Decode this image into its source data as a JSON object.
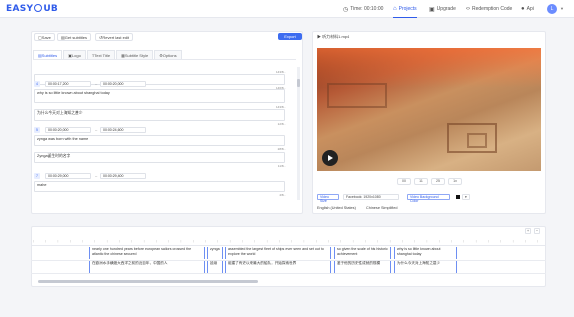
{
  "header": {
    "logo_text": "EASY",
    "logo_text2": "UB",
    "nav": [
      {
        "label": "Time: 00:10:00",
        "icon": "clock-icon"
      },
      {
        "label": "Projects",
        "icon": "home-icon"
      },
      {
        "label": "Upgrade",
        "icon": "lock-icon"
      },
      {
        "label": "Redemption Code",
        "icon": "code-icon"
      },
      {
        "label": "Api",
        "icon": "github-icon"
      }
    ],
    "avatar": "L"
  },
  "toolbar": {
    "save": "Save",
    "get_subtitles": "Get subtitles",
    "revert": "Revert last edit",
    "export": "Export"
  },
  "tabs": [
    "Subtitles",
    "Logo",
    "Text Title",
    "Subtitle Style",
    "Options"
  ],
  "subtitles": [
    {
      "index": "",
      "start": "",
      "end": "",
      "text": "",
      "count": "143/8..."
    },
    {
      "index": "",
      "start": "",
      "end": "",
      "text": "",
      "count": "146/8..."
    },
    {
      "index": "4",
      "start": "00:00:17,200",
      "end": "00:00:20,000",
      "text": "why is so little known about shanghai today",
      "count": "143/8..."
    },
    {
      "index": "",
      "start": "",
      "end": "",
      "text": "为什么今天对上海知之甚少",
      "count": "12/8..."
    },
    {
      "index": "5",
      "start": "00:00:20,000",
      "end": "00:00:24,600",
      "text": "zynga was born with the name",
      "count": "28/8..."
    },
    {
      "index": "",
      "start": "",
      "end": "",
      "text": "Zynga诞生时的名字",
      "count": "11/8..."
    },
    {
      "index": "7",
      "start": "00:00:29,000",
      "end": "00:00:29,400",
      "text": "mahe",
      "count": "4/8..."
    }
  ],
  "video": {
    "title": "听力材料1.mp4",
    "controls": [
      "00",
      "11",
      "25",
      "1x"
    ]
  },
  "video_options": {
    "video_size": "Video Size",
    "size_value": "Facebook: 1920x1080",
    "bg_color": "Video Background Color",
    "bg_color_value": "#000000"
  },
  "languages": [
    "English (United States)",
    "Chinese Simplified"
  ],
  "timeline": {
    "clips": [
      {
        "en": "nearly one hundred years before european sailors crossed the atlantic the chinese secured",
        "zh": "在欧洲水手横渡大西洋之前的近百年，中国的人"
      },
      {
        "en": "zynga",
        "zh": "延续"
      },
      {
        "en": "assembled the largest fleet of ships ever seen and set out to explore the world",
        "zh": "组建了有史以来最大的船队，开始探索世界"
      },
      {
        "en": "so given the scale of his historic achievement",
        "zh": "鉴于他的历史性成就的规模"
      },
      {
        "en": "why is so little known about shanghai today",
        "zh": "为什么今天对上海知之甚少"
      }
    ]
  }
}
